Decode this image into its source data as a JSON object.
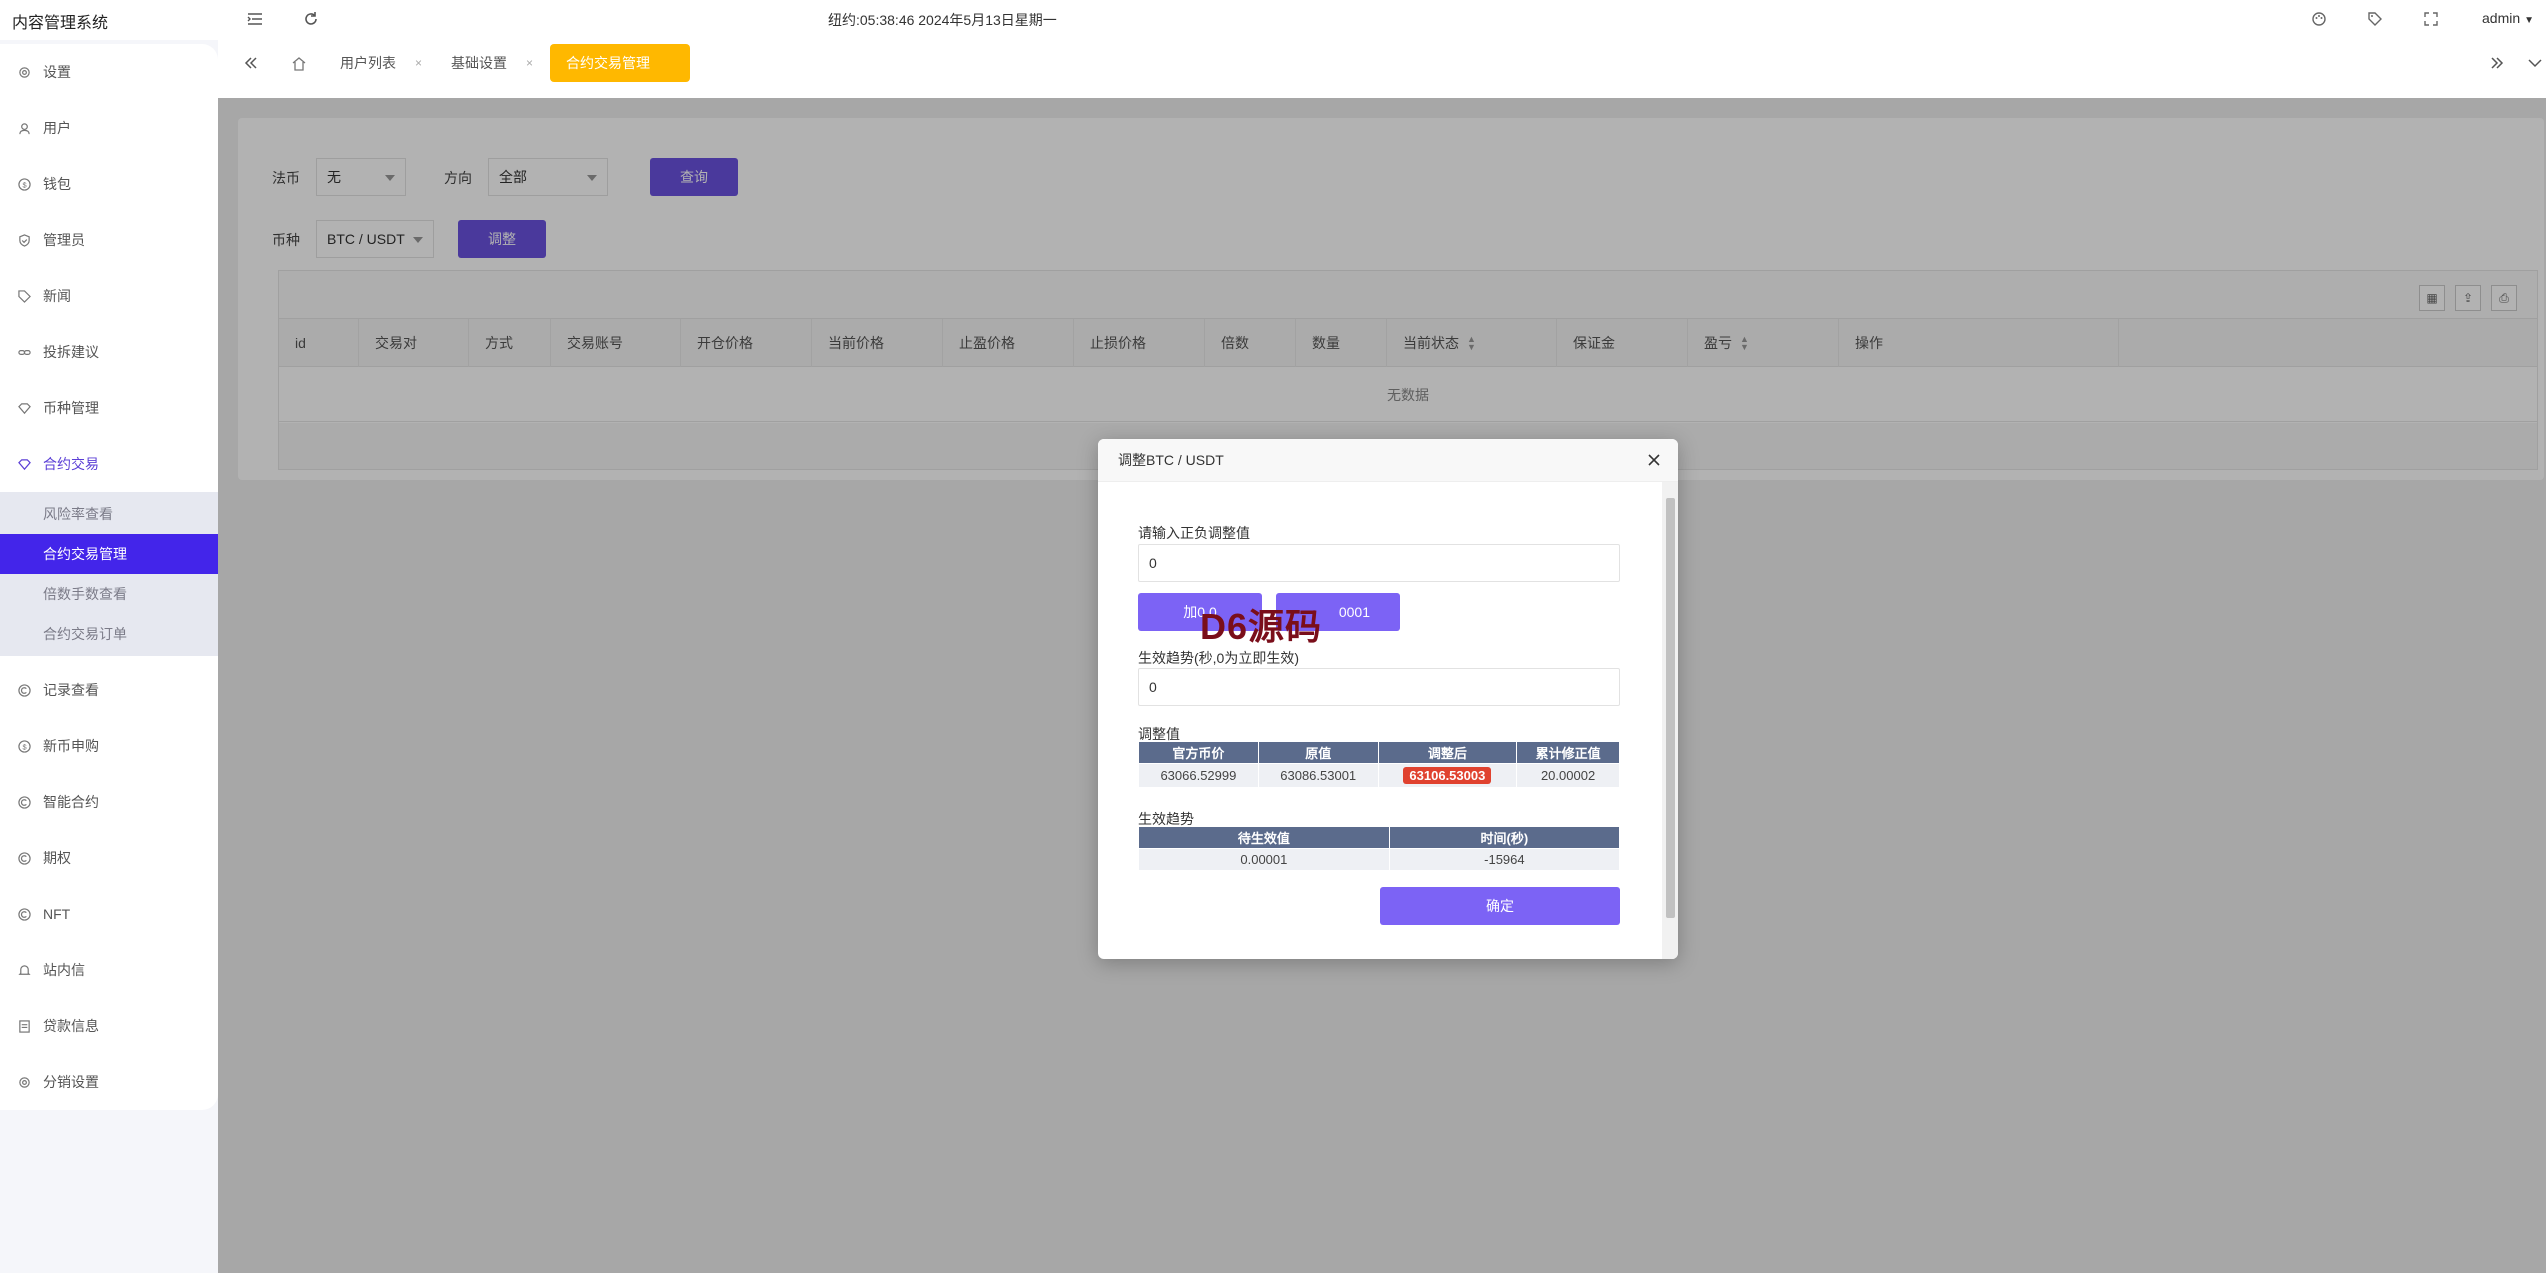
{
  "header": {
    "app_title": "内容管理系统",
    "clock": "纽约:05:38:46 2024年5月13日星期一",
    "user": "admin"
  },
  "icons": {
    "menu_toggle": "hamburger-icon",
    "refresh": "refresh-icon",
    "theme": "palette-icon",
    "tag": "tag-icon",
    "fullscreen": "fullscreen-icon"
  },
  "sidebar": {
    "items": [
      {
        "label": "设置",
        "icon": "gear-icon"
      },
      {
        "label": "用户",
        "icon": "user-icon"
      },
      {
        "label": "钱包",
        "icon": "dollar-icon"
      },
      {
        "label": "管理员",
        "icon": "shield-icon"
      },
      {
        "label": "新闻",
        "icon": "tag-icon"
      },
      {
        "label": "投拆建议",
        "icon": "link-icon"
      },
      {
        "label": "币种管理",
        "icon": "diamond-icon"
      },
      {
        "label": "合约交易",
        "icon": "diamond-icon"
      },
      {
        "label": "记录查看",
        "icon": "circle-c-icon"
      },
      {
        "label": "新币申购",
        "icon": "dollar-icon"
      },
      {
        "label": "智能合约",
        "icon": "circle-c-icon"
      },
      {
        "label": "期权",
        "icon": "circle-c-icon"
      },
      {
        "label": "NFT",
        "icon": "circle-c-icon"
      },
      {
        "label": "站内信",
        "icon": "bell-icon"
      },
      {
        "label": "贷款信息",
        "icon": "document-icon"
      },
      {
        "label": "分销设置",
        "icon": "gear-icon"
      }
    ],
    "submenu": [
      {
        "label": "风险率查看"
      },
      {
        "label": "合约交易管理"
      },
      {
        "label": "倍数手数查看"
      },
      {
        "label": "合约交易订单"
      }
    ]
  },
  "tabs": {
    "items": [
      {
        "label": "用户列表"
      },
      {
        "label": "基础设置"
      },
      {
        "label": "合约交易管理"
      }
    ],
    "close_glyph": "×"
  },
  "filters": {
    "fiat_label": "法币",
    "fiat_value": "无",
    "direction_label": "方向",
    "direction_value": "全部",
    "query_button": "查询",
    "coin_label": "币种",
    "coin_value": "BTC / USDT",
    "adjust_button": "调整"
  },
  "table": {
    "columns": [
      "id",
      "交易对",
      "方式",
      "交易账号",
      "开仓价格",
      "当前价格",
      "止盈价格",
      "止损价格",
      "倍数",
      "数量",
      "当前状态",
      "保证金",
      "盈亏",
      "操作"
    ],
    "empty_text": "无数据"
  },
  "modal": {
    "title": "调整BTC / USDT",
    "adjust_label": "请输入正负调整值",
    "adjust_value": "0",
    "plus_button": "加0.0",
    "minus_button": "0001",
    "watermark": "D6源码",
    "delay_label": "生效趋势(秒,0为立即生效)",
    "delay_value": "0",
    "adjust_table_label": "调整值",
    "adjust_table": {
      "headers": [
        "官方币价",
        "原值",
        "调整后",
        "累计修正值"
      ],
      "row": [
        "63066.52999",
        "63086.53001",
        "63106.53003",
        "20.00002"
      ]
    },
    "trend_label": "生效趋势",
    "trend_table": {
      "headers": [
        "待生效值",
        "时间(秒)"
      ],
      "row": [
        "0.00001",
        "-15964"
      ]
    },
    "confirm_button": "确定"
  },
  "colors": {
    "primary": "#6a52e0",
    "active_tab": "#ffb800",
    "active_submenu": "#4325ea",
    "highlight": "#e0422f"
  }
}
